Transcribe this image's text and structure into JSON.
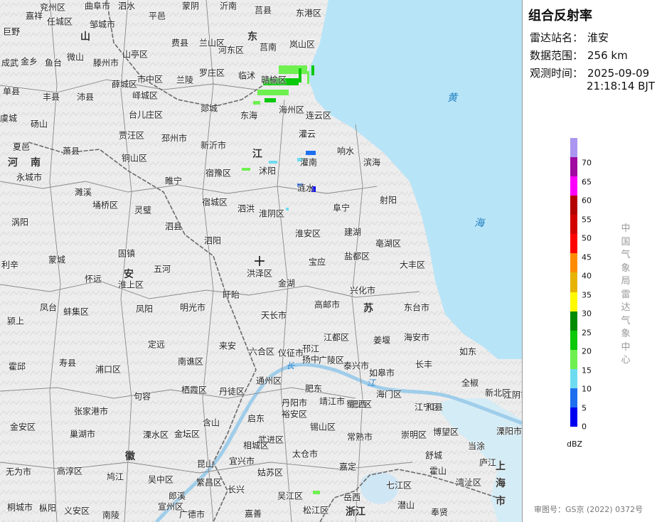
{
  "panel": {
    "title": "组合反射率",
    "station_label": "雷达站名：",
    "station_value": "淮安",
    "range_label": "数据范围：",
    "range_value": "256 km",
    "time_label": "观测时间：",
    "time_date": "2025-09-09",
    "time_clock": "21:18:14 BJT",
    "unit": "dBZ",
    "source": "中国气象局雷达气象中心",
    "approval": "审图号：GS京 (2022) 0372号"
  },
  "legend": [
    {
      "value": "0",
      "color": "#0000f0"
    },
    {
      "value": "5",
      "color": "#1e6ef0"
    },
    {
      "value": "10",
      "color": "#6edcf0"
    },
    {
      "value": "15",
      "color": "#6ef050"
    },
    {
      "value": "20",
      "color": "#0ac80a"
    },
    {
      "value": "25",
      "color": "#008c00"
    },
    {
      "value": "30",
      "color": "#fffa00"
    },
    {
      "value": "35",
      "color": "#e6b400"
    },
    {
      "value": "40",
      "color": "#ff8c00"
    },
    {
      "value": "45",
      "color": "#ff0000"
    },
    {
      "value": "50",
      "color": "#d20000"
    },
    {
      "value": "55",
      "color": "#b40000"
    },
    {
      "value": "60",
      "color": "#ff00ff"
    },
    {
      "value": "65",
      "color": "#a00aa0"
    },
    {
      "value": "70",
      "color": "#aa96f0"
    }
  ],
  "map": {
    "provinces": [
      "山",
      "东",
      "江",
      "苏",
      "河",
      "南",
      "安",
      "徽",
      "浙江",
      "上",
      "海",
      "市"
    ],
    "seas": [
      "黄",
      "海"
    ],
    "rivers": [
      "长",
      "江"
    ],
    "cities": [
      "兖州区",
      "曲阜市",
      "泗水",
      "蒙阴",
      "沂南",
      "莒县",
      "东港区",
      "嘉祥",
      "任城区",
      "邹城市",
      "平邑",
      "费县",
      "兰山区",
      "河东区",
      "莒南",
      "岚山区",
      "巨野",
      "成武",
      "金乡",
      "鱼台",
      "微山",
      "滕州市",
      "山亭区",
      "市中区",
      "兰陵",
      "罗庄区",
      "临沭",
      "赣榆区",
      "单县",
      "丰县",
      "沛县",
      "薛城区",
      "峄城区",
      "台儿庄区",
      "郯城",
      "东海",
      "海州区",
      "连云区",
      "虞城",
      "砀山",
      "贾汪区",
      "邳州市",
      "灌云",
      "夏邑",
      "萧县",
      "铜山区",
      "新沂市",
      "响水",
      "永城市",
      "睢宁",
      "宿豫区",
      "沭阳",
      "灌南",
      "滨海",
      "濉溪",
      "埇桥区",
      "灵璧",
      "宿城区",
      "涟水",
      "射阳",
      "涡阳",
      "泗县",
      "泗阳",
      "淮阴区",
      "阜宁",
      "泗洪",
      "淮安区",
      "建湖",
      "亳湖区",
      "蒙城",
      "固镇",
      "盐都区",
      "利辛",
      "怀远",
      "五河",
      "洪泽区",
      "宝应",
      "大丰区",
      "淮上区",
      "盱眙",
      "金湖",
      "兴化市",
      "凤台",
      "蚌集区",
      "凤阳",
      "明光市",
      "天长市",
      "高邮市",
      "东台市",
      "颍上",
      "江都区",
      "姜堰",
      "海安市",
      "定远",
      "来安",
      "六合区",
      "仪征市",
      "邗江",
      "广陵区",
      "如东",
      "霍邱",
      "寿县",
      "南谯区",
      "扬中",
      "泰兴市",
      "如皋市",
      "长丰",
      "浦口区",
      "栖霞区",
      "丹徒区",
      "通州区",
      "肥东",
      "全椒",
      "句容",
      "丹阳市",
      "靖江市",
      "海门区",
      "蜀山区",
      "江宁区",
      "新北区",
      "张家港市",
      "启东",
      "裕安区",
      "肥西",
      "和县",
      "江阴市",
      "金安区",
      "巢湖市",
      "含山",
      "溧水区",
      "金坛区",
      "武进区",
      "锡山区",
      "常熟市",
      "崇明区",
      "博望区",
      "溧阳市",
      "相城区",
      "太仓市",
      "舒城",
      "当涂",
      "高淳区",
      "宜兴市",
      "姑苏区",
      "嘉定",
      "霍山",
      "庐江",
      "无为市",
      "鸠江",
      "吴中区",
      "昆山",
      "七江区",
      "湾沚区",
      "繁昌区",
      "郎溪",
      "长兴",
      "吴江区",
      "岳西",
      "潜山",
      "桐城市",
      "枞阳",
      "义安区",
      "南陵",
      "宣州区",
      "广德市",
      "嘉善",
      "松江区",
      "奉贤"
    ]
  }
}
